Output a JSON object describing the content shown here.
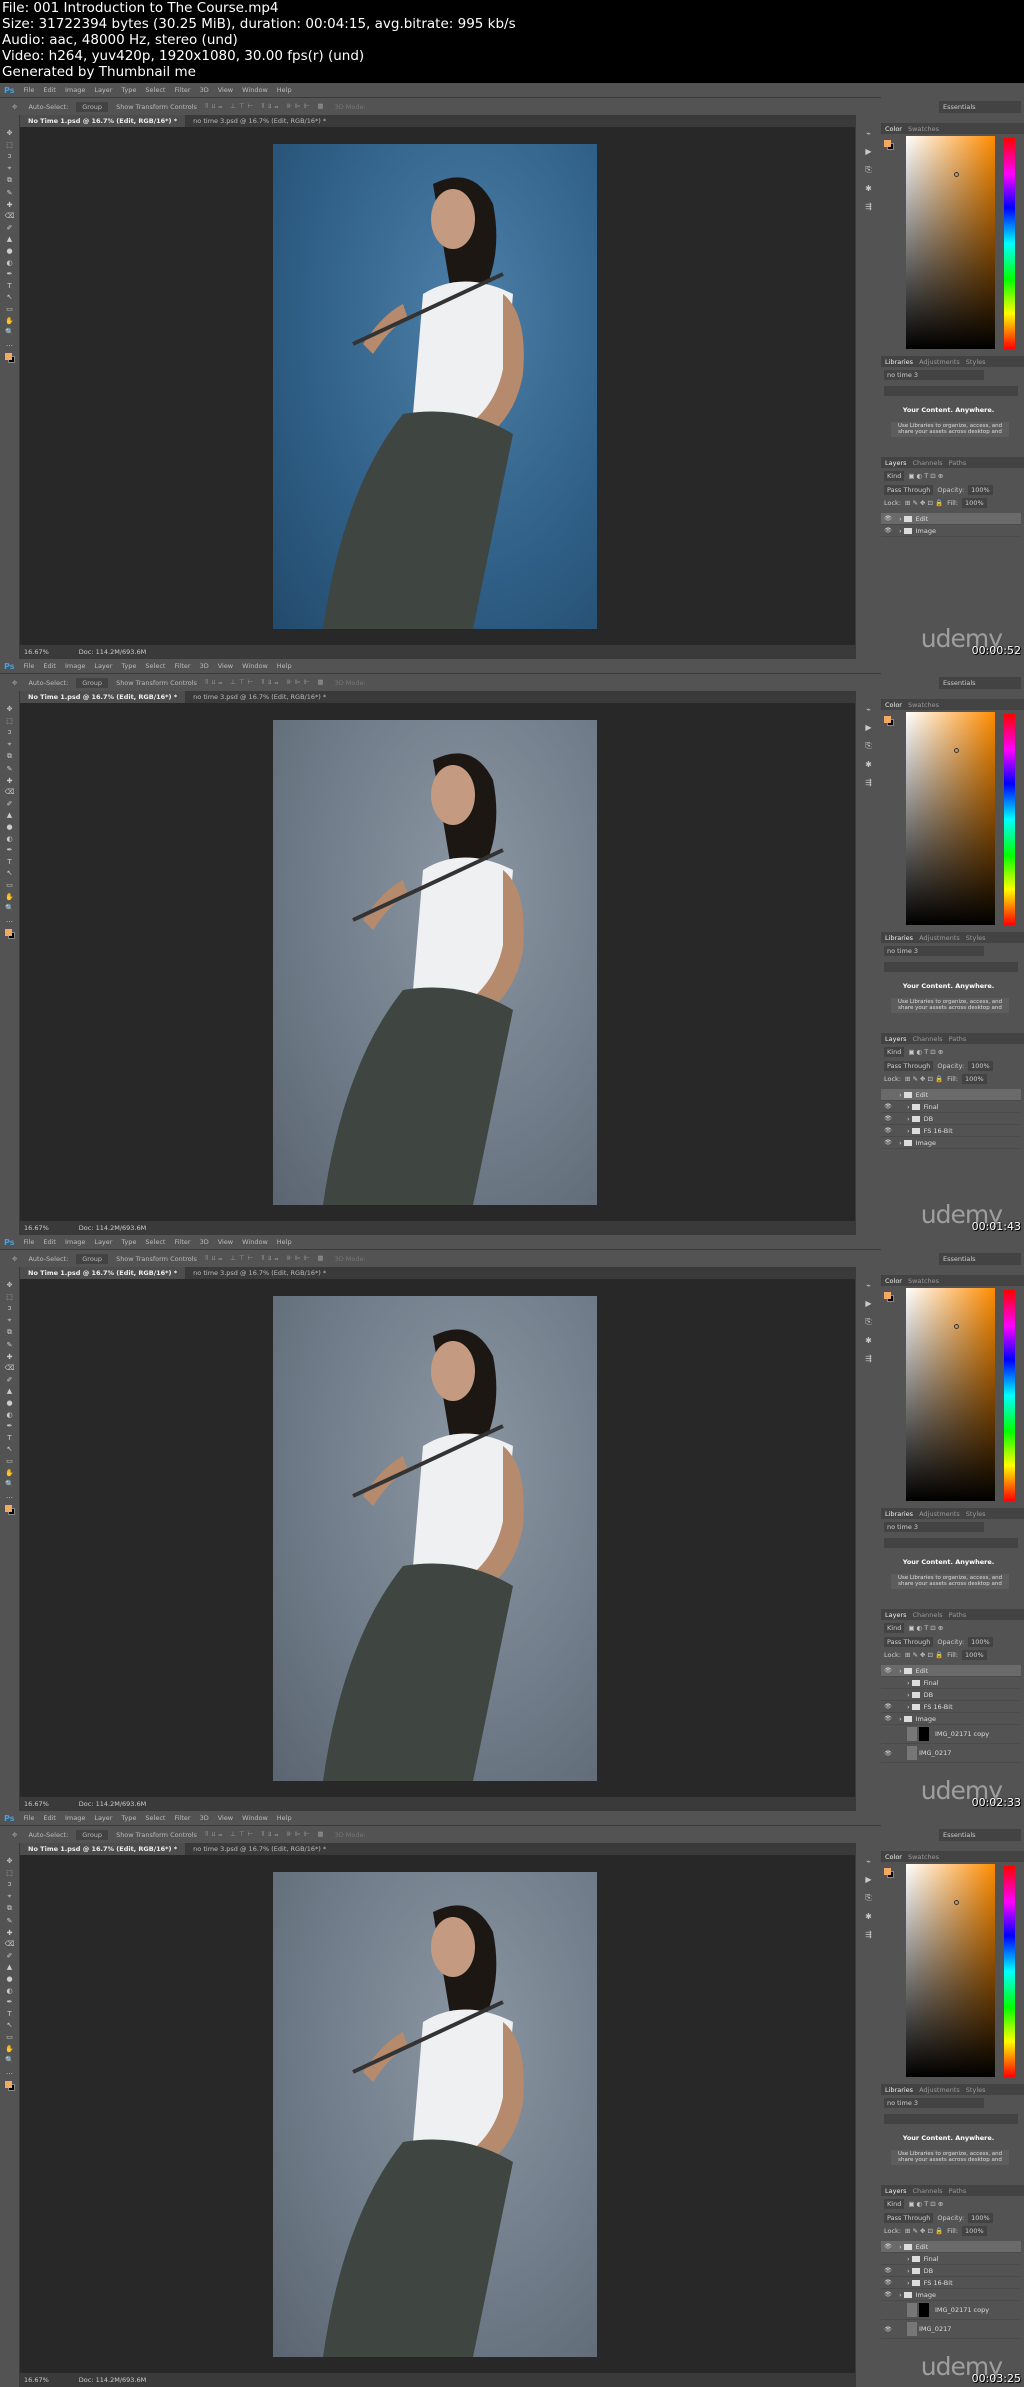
{
  "header": {
    "lines": [
      "File: 001 Introduction to The Course.mp4",
      "Size: 31722394 bytes (30.25 MiB), duration: 00:04:15, avg.bitrate: 995 kb/s",
      "Audio: aac, 48000 Hz, stereo (und)",
      "Video: h264, yuv420p, 1920x1080, 30.00 fps(r) (und)",
      "Generated by Thumbnail me"
    ]
  },
  "app": {
    "logo": "Ps",
    "menu": [
      "File",
      "Edit",
      "Image",
      "Layer",
      "Type",
      "Select",
      "Filter",
      "3D",
      "View",
      "Window",
      "Help"
    ],
    "options": {
      "auto_select": "Auto-Select:",
      "group": "Group",
      "show_transform": "Show Transform Controls",
      "mode3d": "3D Mode:"
    },
    "doc_tabs": [
      "No Time 1.psd @ 16.7% (Edit, RGB/16*) *",
      "no time 3.psd @ 16.7% (Edit, RGB/16*) *"
    ],
    "status": {
      "zoom": "16.67%",
      "doc": "Doc: 114.2M/693.6M"
    },
    "workspace": "Essentials",
    "color_tabs": [
      "Color",
      "Swatches"
    ],
    "lib_tabs": [
      "Libraries",
      "Adjustments",
      "Styles"
    ],
    "library": "no time 3",
    "lib_title": "Your Content. Anywhere.",
    "lib_desc": "Use Libraries to organize, access, and share your assets across desktop and",
    "layer_tabs": [
      "Layers",
      "Channels",
      "Paths"
    ],
    "kind": "Kind",
    "blend": "Pass Through",
    "opacity_label": "Opacity:",
    "opacity": "100%",
    "lock": "Lock:",
    "fill_label": "Fill:",
    "fill": "100%",
    "watermark": "udemy",
    "colors": {
      "foreground": "#f3a960",
      "background": "#000000",
      "accent": "#4a9fd8"
    }
  },
  "frames": [
    {
      "timestamp": "00:00:52",
      "photo": "blue",
      "layers": [
        {
          "name": "Edit",
          "level": 0,
          "selected": true,
          "visible": true
        },
        {
          "name": "Image",
          "level": 0,
          "visible": true
        }
      ]
    },
    {
      "timestamp": "00:01:43",
      "photo": "gray",
      "layers": [
        {
          "name": "Edit",
          "level": 0,
          "selected": true,
          "visible": false
        },
        {
          "name": "Final",
          "level": 1,
          "visible": true
        },
        {
          "name": "DB",
          "level": 1,
          "visible": true
        },
        {
          "name": "FS 16-Bit",
          "level": 1,
          "visible": true
        },
        {
          "name": "Image",
          "level": 0,
          "visible": true
        }
      ]
    },
    {
      "timestamp": "00:02:33",
      "photo": "gray",
      "layers": [
        {
          "name": "Edit",
          "level": 0,
          "selected": true,
          "visible": true
        },
        {
          "name": "Final",
          "level": 1,
          "visible": false
        },
        {
          "name": "DB",
          "level": 1,
          "visible": false
        },
        {
          "name": "FS 16-Bit",
          "level": 1,
          "visible": true
        },
        {
          "name": "Image",
          "level": 0,
          "visible": true
        },
        {
          "name": "IMG_02171 copy",
          "level": 1,
          "visible": false,
          "mask": true
        },
        {
          "name": "IMG_0217",
          "level": 1,
          "visible": true,
          "thumb": true
        }
      ]
    },
    {
      "timestamp": "00:03:25",
      "photo": "gray",
      "layers": [
        {
          "name": "Edit",
          "level": 0,
          "selected": true,
          "visible": true
        },
        {
          "name": "Final",
          "level": 1,
          "visible": false
        },
        {
          "name": "DB",
          "level": 1,
          "visible": true
        },
        {
          "name": "FS 16-Bit",
          "level": 1,
          "visible": true
        },
        {
          "name": "Image",
          "level": 0,
          "visible": true
        },
        {
          "name": "IMG_02171 copy",
          "level": 1,
          "visible": false,
          "mask": true
        },
        {
          "name": "IMG_0217",
          "level": 1,
          "visible": true,
          "thumb": true
        }
      ]
    }
  ]
}
